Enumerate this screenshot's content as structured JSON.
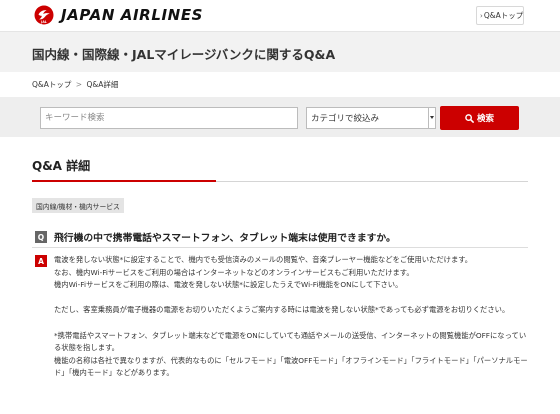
{
  "header": {
    "brand": "JAPAN AIRLINES",
    "logo_icon": "crane-logo-icon",
    "top_link_label": "Q&Aトップ"
  },
  "page_title": "国内線・国際線・JALマイレージバンクに関するQ&A",
  "breadcrumb": {
    "items": [
      "Q&Aトップ",
      "Q&A詳細"
    ],
    "separator": ">"
  },
  "search": {
    "keyword_placeholder": "キーワード検索",
    "keyword_value": "",
    "category_selected": "カテゴリで絞込み",
    "button_label": "検索"
  },
  "section_title": "Q&A 詳細",
  "category_tag": "国内線/機材・機内サービス",
  "question": {
    "mark": "Q",
    "text": "飛行機の中で携帯電話やスマートフォン、タブレット端末は使用できますか。"
  },
  "answer": {
    "mark": "A",
    "lines": [
      "電波を発しない状態*に設定することで、機内でも受信済みのメールの閲覧や、音楽プレーヤー機能などをご使用いただけます。",
      "なお、機内Wi-Fiサービスをご利用の場合はインターネットなどのオンラインサービスもご利用いただけます。",
      "機内Wi-Fiサービスをご利用の際は、電波を発しない状態*に設定したうえでWi-Fi機能をONにして下さい。",
      "",
      "ただし、客室乗務員が電子機器の電源をお切りいただくようご案内する時には電波を発しない状態*であっても必ず電源をお切りください。",
      "",
      "*携帯電話やスマートフォン、タブレット端末などで電源をONにしていても通話やメールの送受信、インターネットの閲覧機能がOFFになっている状態を指します。",
      "機能の名称は各社で異なりますが、代表的なものに「セルフモード」「電波OFFモード」「オフラインモード」「フライトモード」「パーソナルモード」「機内モード」などがあります。"
    ]
  },
  "colors": {
    "brand_red": "#cc0000",
    "band_gray": "#f2f2f2",
    "q_mark_gray": "#666666"
  }
}
